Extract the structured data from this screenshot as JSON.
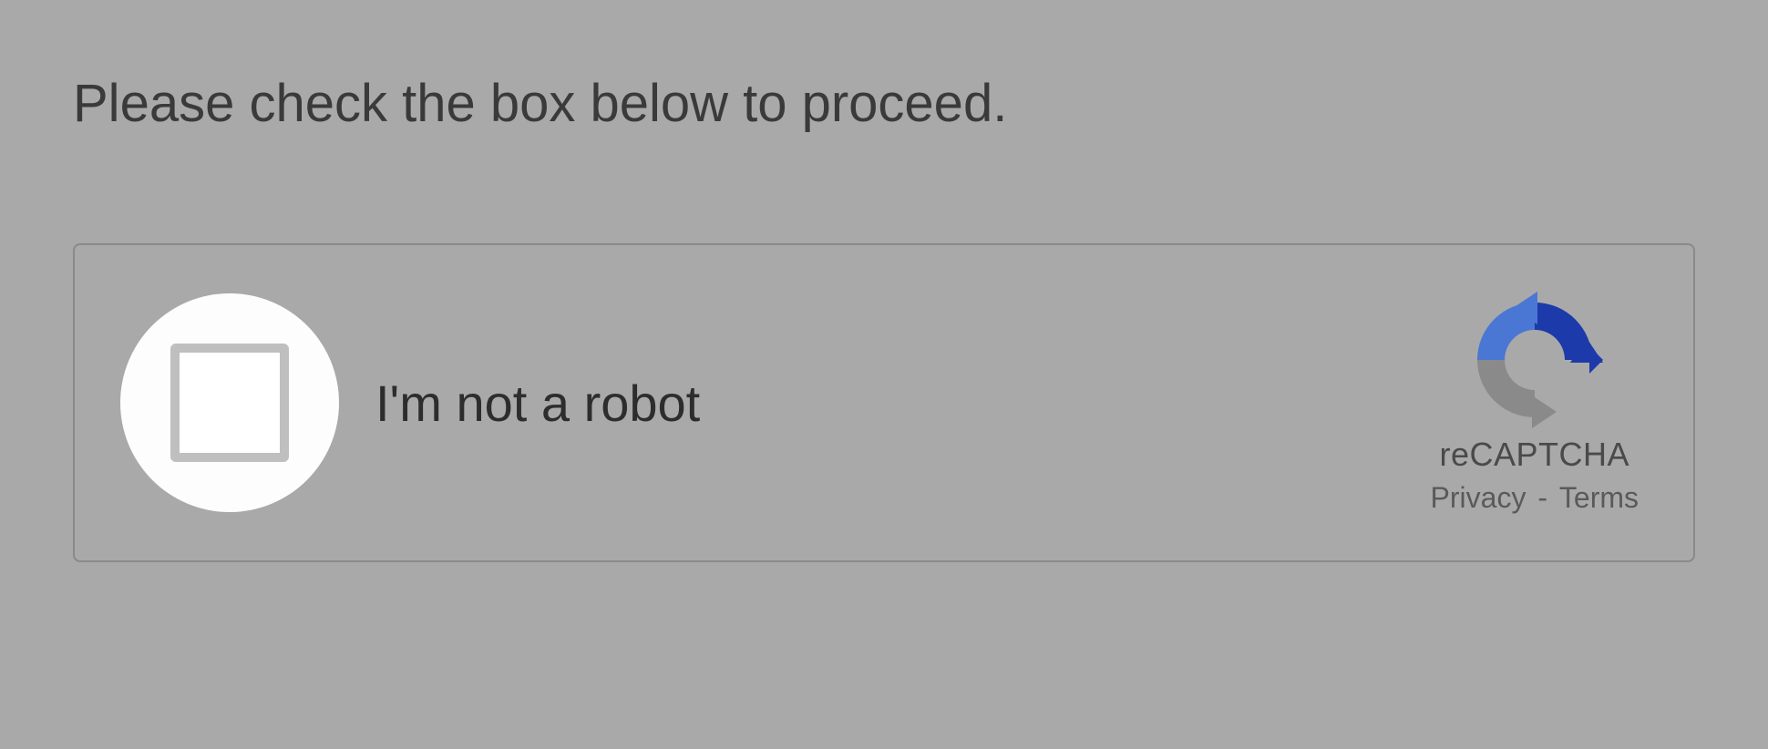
{
  "instruction": "Please check the box below to proceed.",
  "captcha": {
    "label": "I'm not a robot",
    "brand": "reCAPTCHA",
    "privacy": "Privacy",
    "terms": "Terms",
    "separator": " - "
  }
}
